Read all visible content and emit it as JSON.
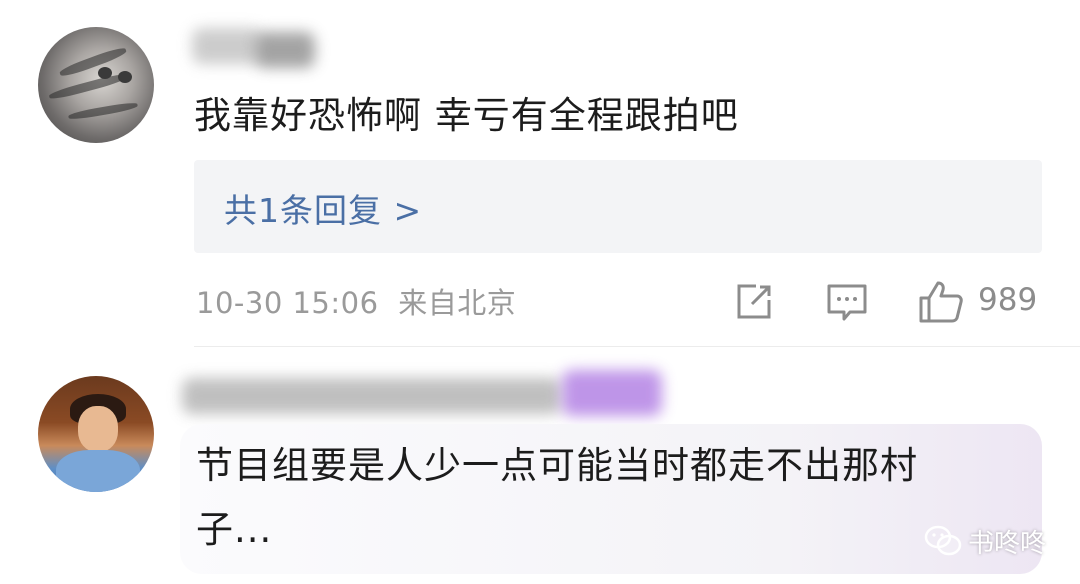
{
  "comments": [
    {
      "text": "我靠好恐怖啊 幸亏有全程跟拍吧",
      "reply_link": "共1条回复 >",
      "timestamp": "10-30 15:06",
      "location": "来自北京",
      "like_count": "989",
      "avatar": "cat-avatar",
      "username_blurred": true
    },
    {
      "text_line1": "节目组要是人少一点可能当时都走不出那村",
      "text_line2": "子...",
      "avatar": "person-avatar",
      "username_blurred": true
    }
  ],
  "actions": [
    "share-icon",
    "comment-icon",
    "like-icon"
  ],
  "watermark": {
    "text": "书咚咚",
    "icon": "wechat-icon"
  },
  "colors": {
    "link": "#4a6fa5",
    "meta": "#9a9a9a",
    "reply_bg": "#f3f4f6",
    "text": "#1c1c1c"
  }
}
